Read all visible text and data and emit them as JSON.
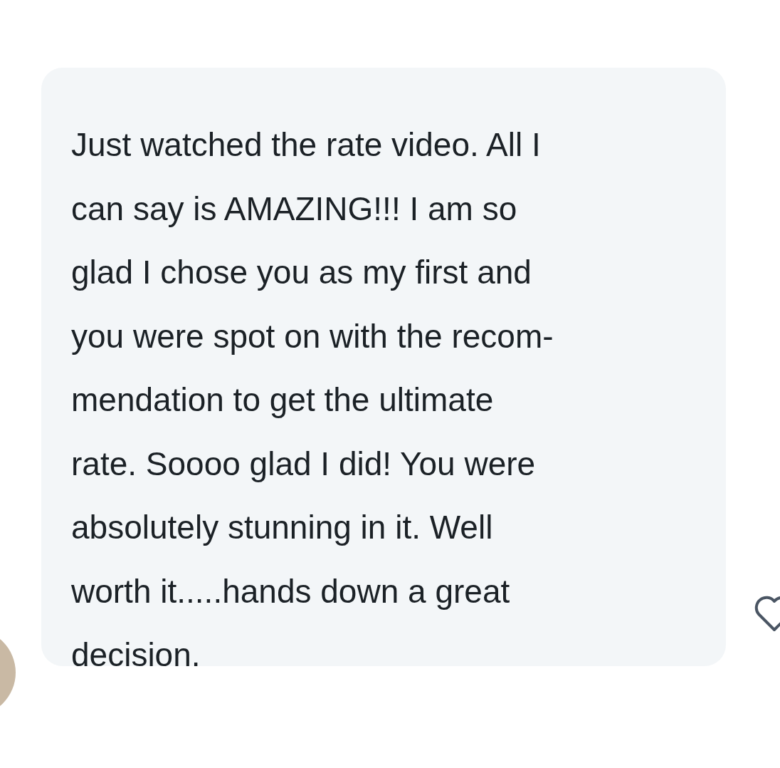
{
  "message": {
    "text": "Just watched the rate video. All I\ncan say is AMAZING!!! I am so\nglad I chose you as my first and\nyou were spot on with the recom-\nmendation to get the ultimate\nrate. Soooo glad I did! You were\nabsolutely stunning in it. Well\nworth it.....hands down a great\ndecision.",
    "liked": false
  }
}
